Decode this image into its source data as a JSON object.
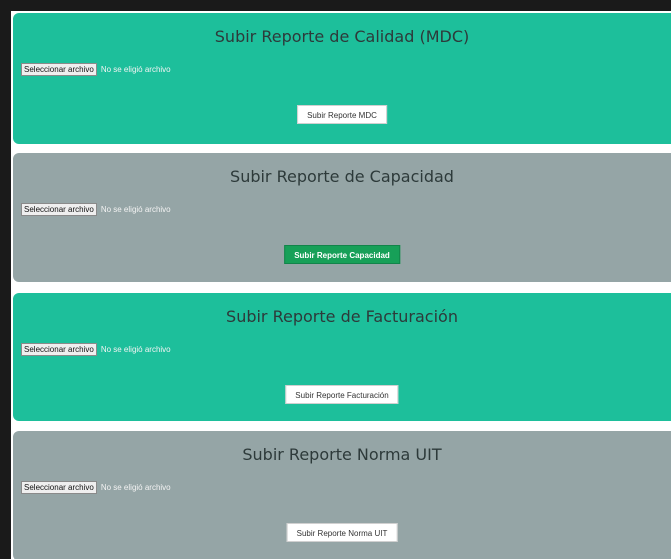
{
  "panels": [
    {
      "title": "Subir Reporte de Calidad (MDC)",
      "file_button_label": "Seleccionar archivo",
      "file_status": "No se eligió archivo",
      "submit_label": "Subir Reporte MDC",
      "color": "#1dbf9b"
    },
    {
      "title": "Subir Reporte de Capacidad",
      "file_button_label": "Seleccionar archivo",
      "file_status": "No se eligió archivo",
      "submit_label": "Subir Reporte Capacidad",
      "color": "#95a5a6",
      "submit_color": "#17a058"
    },
    {
      "title": "Subir Reporte de Facturación",
      "file_button_label": "Seleccionar archivo",
      "file_status": "No se eligió archivo",
      "submit_label": "Subir Reporte Facturación",
      "color": "#1dbf9b"
    },
    {
      "title": "Subir Reporte Norma UIT",
      "file_button_label": "Seleccionar archivo",
      "file_status": "No se eligió archivo",
      "submit_label": "Subir Reporte Norma UIT",
      "color": "#95a5a6"
    }
  ]
}
